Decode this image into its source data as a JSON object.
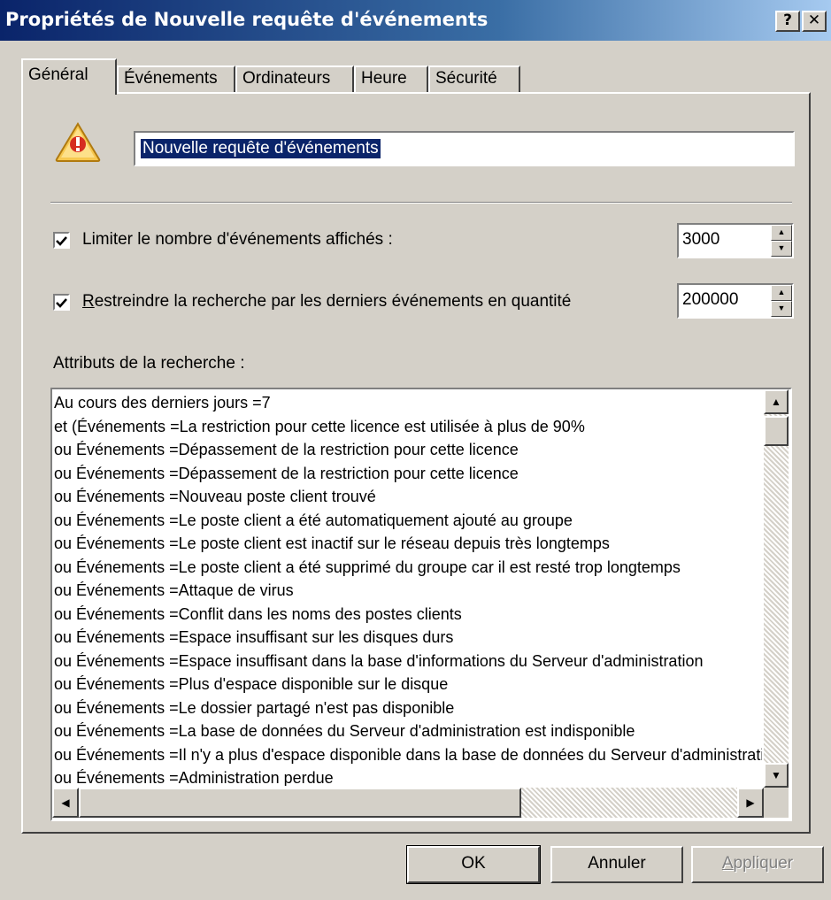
{
  "window": {
    "title": "Propriétés de Nouvelle requête d'événements",
    "help_label": "?",
    "close_label": "✕"
  },
  "tabs": [
    {
      "label": "Général",
      "active": true
    },
    {
      "label": "Événements"
    },
    {
      "label": "Ordinateurs"
    },
    {
      "label": "Heure"
    },
    {
      "label": "Sécurité"
    }
  ],
  "icon": "warning-icon",
  "query_name": "Nouvelle requête d'événements",
  "limit_events": {
    "checked": true,
    "label": "Limiter le nombre d'événements affichés :",
    "value": "3000"
  },
  "restrict_search": {
    "checked": true,
    "label_accel": "R",
    "label_rest": "estreindre la recherche par les derniers événements en quantité",
    "value": "200000"
  },
  "attributes_label": "Attributs de la recherche :",
  "attributes": [
    "Au cours des derniers jours =7",
    "et (Événements =La restriction pour cette licence est utilisée à plus de 90%",
    "ou Événements =Dépassement de la restriction pour cette licence",
    "ou Événements =Dépassement de la restriction pour cette licence",
    "ou Événements =Nouveau poste client trouvé",
    "ou Événements =Le poste client a été automatiquement ajouté au groupe",
    "ou Événements =Le poste client est inactif sur le réseau depuis très longtemps",
    "ou Événements =Le poste client a été supprimé du groupe car il est resté trop longtemps",
    "ou Événements =Attaque de virus",
    "ou Événements =Conflit dans les noms des postes clients",
    "ou Événements =Espace insuffisant sur les disques durs",
    "ou Événements =Espace insuffisant dans la base d'informations du Serveur d'administration",
    "ou Événements =Plus d'espace disponible sur le disque",
    "ou Événements =Le dossier partagé n'est pas disponible",
    "ou Événements =La base de données du Serveur d'administration est indisponible",
    "ou Événements =Il n'y a plus d'espace disponible dans la base de données du Serveur d'administration",
    "ou Événements =Administration perdue"
  ],
  "buttons": {
    "ok": "OK",
    "cancel": "Annuler",
    "apply_accel": "A",
    "apply_rest": "ppliquer"
  }
}
